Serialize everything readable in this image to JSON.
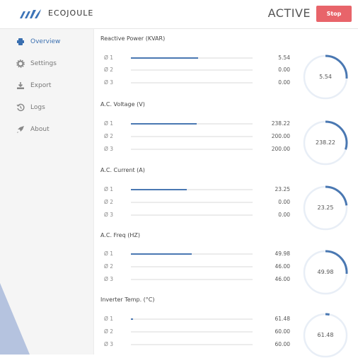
{
  "header": {
    "brand": "ECOJOULE",
    "status": "ACTIVE",
    "stop_label": "Stop",
    "stop_color": "#e8646a"
  },
  "sidebar": {
    "items": [
      {
        "label": "Overview",
        "icon": "dashboard-icon",
        "active": true
      },
      {
        "label": "Settings",
        "icon": "gear-icon",
        "active": false
      },
      {
        "label": "Export",
        "icon": "download-icon",
        "active": false
      },
      {
        "label": "Logs",
        "icon": "history-icon",
        "active": false
      },
      {
        "label": "About",
        "icon": "rocket-icon",
        "active": false
      }
    ]
  },
  "colors": {
    "accent": "#4a78b2",
    "track": "#ececec",
    "gauge_track": "#e8eef6",
    "active_nav": "#3a6fb0"
  },
  "sections": [
    {
      "title": "Reactive Power (KVAR)",
      "gauge_value": "5.54",
      "gauge_fraction": 0.26,
      "phases": [
        {
          "label": "Ø 1",
          "value": "5.54",
          "fraction": 0.55
        },
        {
          "label": "Ø 2",
          "value": "0.00",
          "fraction": 0
        },
        {
          "label": "Ø 3",
          "value": "0.00",
          "fraction": 0
        }
      ]
    },
    {
      "title": "A.C. Voltage (V)",
      "gauge_value": "238.22",
      "gauge_fraction": 0.3,
      "phases": [
        {
          "label": "Ø 1",
          "value": "238.22",
          "fraction": 0.54
        },
        {
          "label": "Ø 2",
          "value": "200.00",
          "fraction": 0
        },
        {
          "label": "Ø 3",
          "value": "200.00",
          "fraction": 0
        }
      ]
    },
    {
      "title": "A.C. Current (A)",
      "gauge_value": "23.25",
      "gauge_fraction": 0.23,
      "phases": [
        {
          "label": "Ø 1",
          "value": "23.25",
          "fraction": 0.46
        },
        {
          "label": "Ø 2",
          "value": "0.00",
          "fraction": 0
        },
        {
          "label": "Ø 3",
          "value": "0.00",
          "fraction": 0
        }
      ]
    },
    {
      "title": "A.C. Freq (HZ)",
      "gauge_value": "49.98",
      "gauge_fraction": 0.26,
      "phases": [
        {
          "label": "Ø 1",
          "value": "49.98",
          "fraction": 0.5
        },
        {
          "label": "Ø 2",
          "value": "46.00",
          "fraction": 0
        },
        {
          "label": "Ø 3",
          "value": "46.00",
          "fraction": 0
        }
      ]
    },
    {
      "title": "Inverter Temp. (°C)",
      "gauge_value": "61.48",
      "gauge_fraction": 0.03,
      "phases": [
        {
          "label": "Ø 1",
          "value": "61.48",
          "fraction": 0.02
        },
        {
          "label": "Ø 2",
          "value": "60.00",
          "fraction": 0
        },
        {
          "label": "Ø 3",
          "value": "60.00",
          "fraction": 0
        }
      ]
    }
  ]
}
